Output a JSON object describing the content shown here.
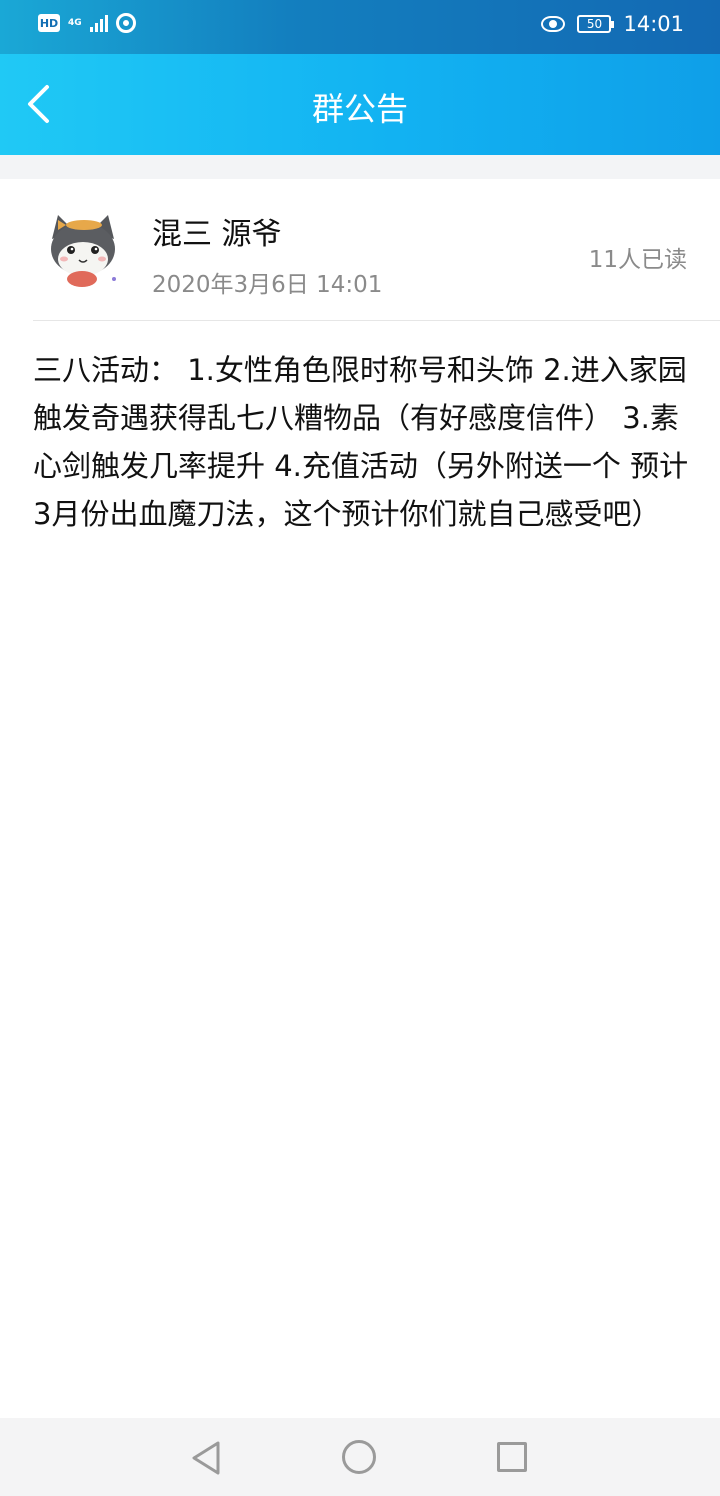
{
  "status_bar": {
    "hd_label": "HD",
    "network_label": "4G",
    "battery": "50",
    "time": "14:01"
  },
  "header": {
    "title": "群公告",
    "back_icon": "chevron-left-icon"
  },
  "announcement": {
    "author": "混三 源爷",
    "date": "2020年3月6日 14:01",
    "read_count": "11人已读",
    "avatar_icon": "cat-avatar",
    "content": "三八活动： 1.女性角色限时称号和头饰 2.进入家园触发奇遇获得乱七八糟物品（有好感度信件） 3.素心剑触发几率提升 4.充值活动（另外附送一个 预计3月份出血魔刀法，这个预计你们就自己感受吧）"
  },
  "system_nav": {
    "back_icon": "triangle-back-icon",
    "home_icon": "circle-home-icon",
    "recent_icon": "square-recents-icon"
  },
  "colors": {
    "header_gradient_start": "#20c9f5",
    "header_gradient_end": "#0f9fe8",
    "status_bar": "#1369b3",
    "text_primary": "#111111",
    "text_secondary": "#8a8a8a"
  }
}
